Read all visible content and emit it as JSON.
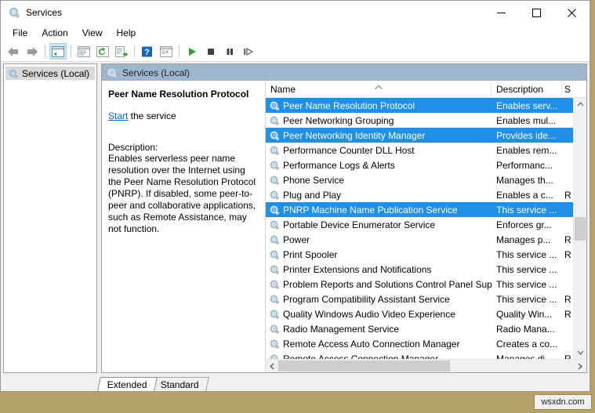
{
  "window": {
    "title": "Services",
    "title_icon": "services-gear-icon",
    "buttons": {
      "minimize": "minimize-icon",
      "maximize": "maximize-icon",
      "close": "close-icon"
    }
  },
  "menu": {
    "items": [
      {
        "label": "File"
      },
      {
        "label": "Action"
      },
      {
        "label": "View"
      },
      {
        "label": "Help"
      }
    ]
  },
  "toolbar": {
    "buttons": [
      {
        "name": "back-button",
        "icon": "left-arrow-icon",
        "pressed": false
      },
      {
        "name": "forward-button",
        "icon": "right-arrow-icon",
        "pressed": false
      },
      {
        "name": "show-hide-console-tree-button",
        "icon": "console-tree-icon",
        "pressed": true
      },
      {
        "name": "show-hide-action-pane-button",
        "icon": "action-pane-icon",
        "pressed": false
      },
      {
        "name": "refresh-button",
        "icon": "refresh-icon",
        "pressed": false
      },
      {
        "name": "export-list-button",
        "icon": "export-list-icon",
        "pressed": false
      },
      {
        "name": "help-button",
        "icon": "help-question-icon",
        "pressed": false
      },
      {
        "name": "properties-button",
        "icon": "properties-icon",
        "pressed": false
      },
      {
        "name": "start-service-button",
        "icon": "play-icon",
        "pressed": false
      },
      {
        "name": "stop-service-button",
        "icon": "stop-icon",
        "pressed": false
      },
      {
        "name": "pause-service-button",
        "icon": "pause-icon",
        "pressed": false
      },
      {
        "name": "restart-service-button",
        "icon": "restart-icon",
        "pressed": false
      }
    ]
  },
  "tree": {
    "nodes": [
      {
        "label": "Services (Local)",
        "icon": "services-gear-icon",
        "selected": true
      }
    ]
  },
  "pane_header": {
    "title": "Services (Local)",
    "icon": "services-gear-icon"
  },
  "details": {
    "service_name": "Peer Name Resolution Protocol",
    "action_link": "Start",
    "action_suffix": " the service",
    "description_label": "Description:",
    "description": "Enables serverless peer name resolution over the Internet using the Peer Name Resolution Protocol (PNRP). If disabled, some peer-to-peer and collaborative applications, such as Remote Assistance, may not function."
  },
  "list": {
    "columns": [
      {
        "key": "name",
        "label": "Name",
        "sorted": "asc"
      },
      {
        "key": "description",
        "label": "Description"
      },
      {
        "key": "status",
        "label": "S"
      }
    ],
    "rows": [
      {
        "name": "Peer Name Resolution Protocol",
        "description": "Enables serv...",
        "status": "",
        "selected": true
      },
      {
        "name": "Peer Networking Grouping",
        "description": "Enables mul...",
        "status": "",
        "selected": false
      },
      {
        "name": "Peer Networking Identity Manager",
        "description": "Provides ide...",
        "status": "",
        "selected": true
      },
      {
        "name": "Performance Counter DLL Host",
        "description": "Enables rem...",
        "status": "",
        "selected": false
      },
      {
        "name": "Performance Logs & Alerts",
        "description": "Performanc...",
        "status": "",
        "selected": false
      },
      {
        "name": "Phone Service",
        "description": "Manages th...",
        "status": "",
        "selected": false
      },
      {
        "name": "Plug and Play",
        "description": "Enables a c...",
        "status": "R",
        "selected": false
      },
      {
        "name": "PNRP Machine Name Publication Service",
        "description": "This service ...",
        "status": "",
        "selected": true
      },
      {
        "name": "Portable Device Enumerator Service",
        "description": "Enforces gr...",
        "status": "",
        "selected": false
      },
      {
        "name": "Power",
        "description": "Manages p...",
        "status": "R",
        "selected": false
      },
      {
        "name": "Print Spooler",
        "description": "This service ...",
        "status": "R",
        "selected": false
      },
      {
        "name": "Printer Extensions and Notifications",
        "description": "This service ...",
        "status": "",
        "selected": false
      },
      {
        "name": "Problem Reports and Solutions Control Panel Supp...",
        "description": "This service ...",
        "status": "",
        "selected": false
      },
      {
        "name": "Program Compatibility Assistant Service",
        "description": "This service ...",
        "status": "R",
        "selected": false
      },
      {
        "name": "Quality Windows Audio Video Experience",
        "description": "Quality Win...",
        "status": "R",
        "selected": false
      },
      {
        "name": "Radio Management Service",
        "description": "Radio Mana...",
        "status": "",
        "selected": false
      },
      {
        "name": "Remote Access Auto Connection Manager",
        "description": "Creates a co...",
        "status": "",
        "selected": false
      },
      {
        "name": "Remote Access Connection Manager",
        "description": "Manages di...",
        "status": "R",
        "selected": false
      }
    ]
  },
  "tabs": [
    {
      "label": "Extended",
      "active": true
    },
    {
      "label": "Standard",
      "active": false
    }
  ],
  "watermark": {
    "text": "wsxdn.com"
  },
  "colors": {
    "selection": "#1e90e8",
    "pane_header": "#9fb6cd",
    "link": "#0066cc",
    "desktop": "#b5a269"
  }
}
